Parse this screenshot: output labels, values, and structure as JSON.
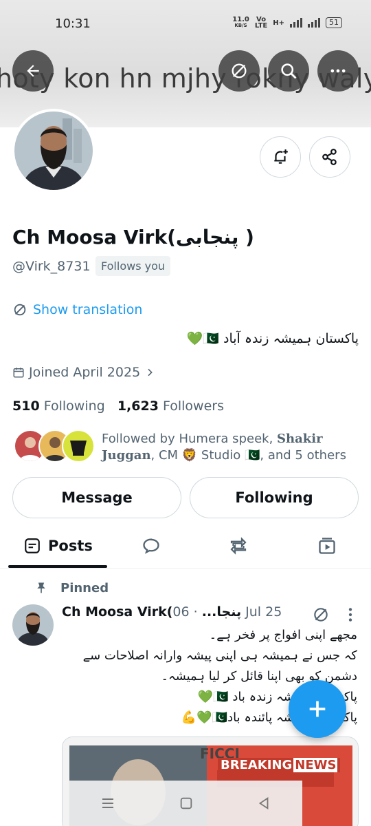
{
  "status_bar": {
    "time": "10:31",
    "net_speed": "11.0",
    "net_unit": "KB/S",
    "volte_top": "Vo",
    "volte_bottom": "LTE",
    "net_type": "H+",
    "battery": "51"
  },
  "banner": {
    "text": "hoty kon hn mjhy rokny waly"
  },
  "profile": {
    "display_name": "Ch Moosa Virk(پنجابی )",
    "handle": "@Virk_8731",
    "follows_you": "Follows you",
    "show_translation": "Show translation",
    "bio": "پاکستان ہمیشہ زندہ آباد 🇵🇰💚",
    "joined": "Joined April 2025",
    "following_count": "510",
    "following_label": "Following",
    "followers_count": "1,623",
    "followers_label": "Followers",
    "followed_by_prefix": "Followed by Humera speek, ",
    "followed_by_bold1": "Shakir Juggan",
    "followed_by_middle": ", CM 🦁 Studio 🇵🇰",
    "followed_by_suffix": ", and 5 others"
  },
  "actions": {
    "message": "Message",
    "following": "Following"
  },
  "tabs": {
    "posts": "Posts"
  },
  "post": {
    "pinned_label": "Pinned",
    "author": "Ch Moosa Virk(پنجا...",
    "date": "· 06 Jul 25",
    "lines": [
      "مجھے اپنی افواج پر فخر ہے۔",
      "کہ جس نے ہمیشہ ہی اپنی پیشہ وارانہ اصلاحات سے",
      "دشمن کو بھی اپنا قائل کر لیا ہمیشہ۔",
      "پاکستان ہمیشہ زندہ باد 🇵🇰💚",
      "پاکستان ہمیشہ پائندہ باد🇵🇰💚💪"
    ],
    "media_logo": "FICCI",
    "media_breaking": "BREAKING",
    "media_news": "NEWS"
  },
  "colors": {
    "accent": "#1d9bf0",
    "text": "#0f1419",
    "muted": "#536471",
    "border": "#cfd9de"
  },
  "icons": [
    "back-arrow-icon",
    "translate-off-icon",
    "search-icon",
    "more-icon",
    "notification-bell-icon",
    "share-icon",
    "calendar-icon",
    "pin-icon",
    "reply-icon",
    "repost-icon",
    "media-icon",
    "compose-plus-icon"
  ]
}
